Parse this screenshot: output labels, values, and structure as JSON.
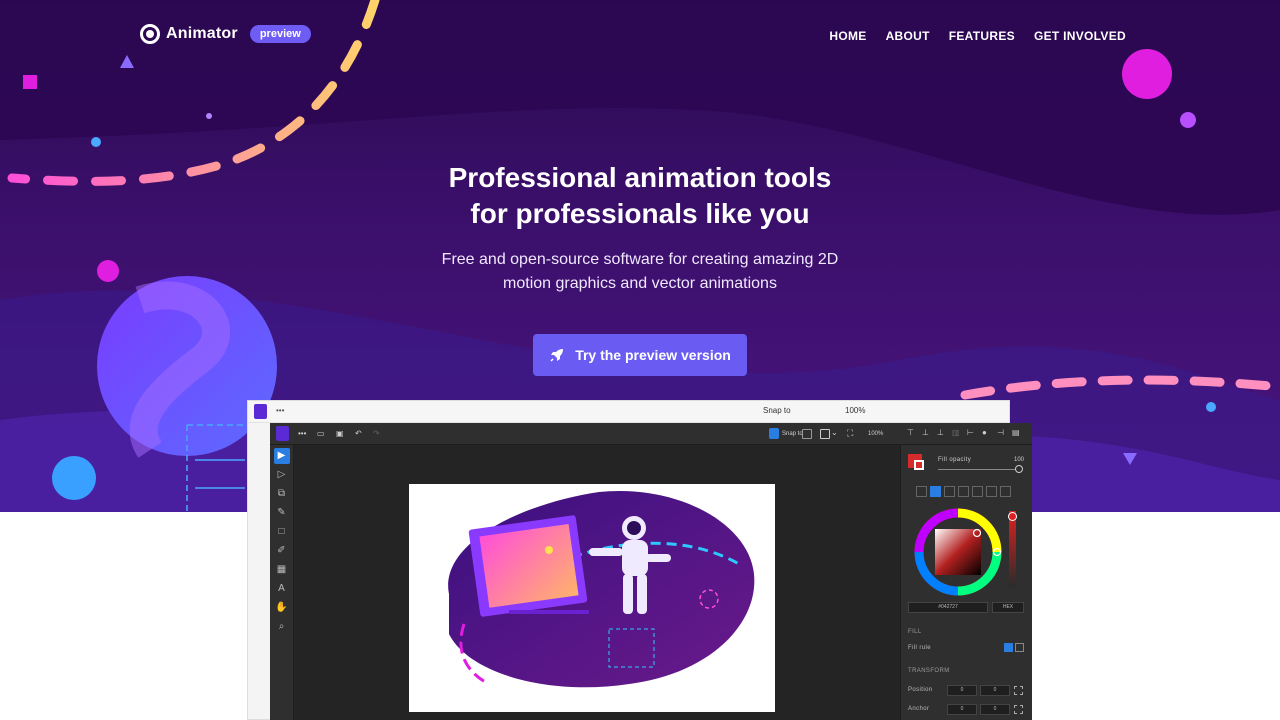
{
  "nav": {
    "brand": "Animator",
    "badge": "preview",
    "links": [
      "HOME",
      "ABOUT",
      "FEATURES",
      "GET INVOLVED"
    ]
  },
  "hero": {
    "headline_line1": "Professional animation tools",
    "headline_line2": "for professionals like you",
    "subline_line1": "Free and open-source software for creating amazing 2D",
    "subline_line2": "motion graphics and vector animations",
    "cta_label": "Try the preview version",
    "cta_icon": "rocket-icon"
  },
  "app": {
    "toolbar": {
      "snap_label": "Snap to",
      "zoom_value": "100%"
    },
    "panel": {
      "fill_opacity_label": "Fill opacity",
      "fill_opacity_value": "100",
      "hex_value": "#042727",
      "color_mode": "HEX",
      "fill_section": "FILL",
      "fill_rule_label": "Fill rule",
      "transform_section": "TRANSFORM",
      "position_label": "Position",
      "anchor_label": "Anchor",
      "position_x": "0",
      "position_y": "0",
      "anchor_x": "0",
      "anchor_y": "0"
    },
    "tools": [
      "select-tool-icon",
      "direct-select-tool-icon",
      "transform-tool-icon",
      "pen-tool-icon",
      "rectangle-tool-icon",
      "eyedropper-tool-icon",
      "table-tool-icon",
      "text-tool-icon",
      "hand-tool-icon",
      "zoom-tool-icon"
    ],
    "tool_glyphs": [
      "▶",
      "▷",
      "⧉",
      "✎",
      "□",
      "✐",
      "▦",
      "A",
      "✋",
      "⌕"
    ]
  },
  "colors": {
    "accent": "#6a5cf2",
    "hero_bg": "#3a0f6a",
    "magenta": "#e01ee0",
    "swatch_red": "#d62b2b"
  }
}
